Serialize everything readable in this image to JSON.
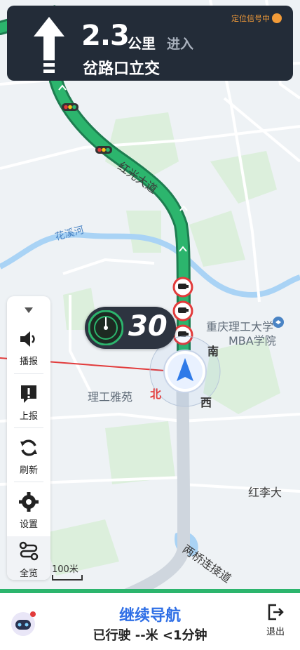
{
  "guidance": {
    "distance": "2.3",
    "unit": "公里",
    "action": "进入",
    "road": "岔路口立交",
    "gps_status": "定位信号中"
  },
  "map_labels": {
    "road1": "红光大道",
    "river": "花溪河",
    "university": "重庆理工大学",
    "mba": "MBA学院",
    "area": "理工雅苑",
    "road2": "红李大",
    "road3": "两桥连接道"
  },
  "compass": {
    "north": "北",
    "south": "南",
    "west": "西"
  },
  "speed": {
    "value": "30"
  },
  "toolbar": {
    "broadcast_label": "播报",
    "report_label": "上报",
    "refresh_label": "刷新",
    "settings_label": "设置",
    "overview_label": "全览"
  },
  "scale": {
    "label": "100米"
  },
  "bottom": {
    "continue_label": "继续导航",
    "trip_info": "已行驶 --米 <1分钟",
    "exit_label": "退出"
  },
  "colors": {
    "route": "#27a56b",
    "panel": "#232c38",
    "accent": "#2f6fe6",
    "warning": "#e23b3b"
  }
}
